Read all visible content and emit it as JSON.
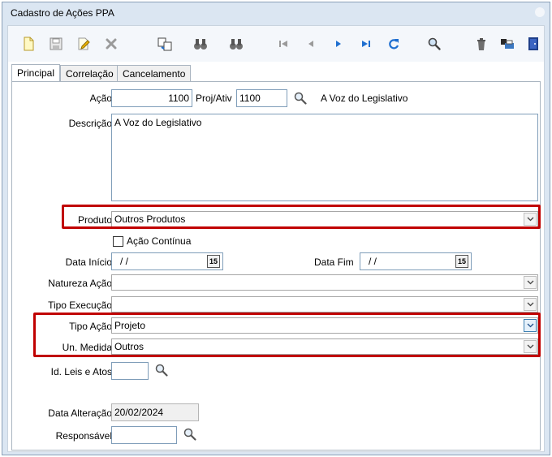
{
  "window": {
    "title": "Cadastro de Ações PPA"
  },
  "toolbar": {
    "buttons": [
      {
        "icon": "new-document-icon"
      },
      {
        "icon": "save-icon"
      },
      {
        "icon": "edit-icon"
      },
      {
        "icon": "delete-icon"
      },
      {
        "icon": "copy-record-icon"
      },
      {
        "icon": "binoculars-icon"
      },
      {
        "icon": "binoculars-next-icon"
      },
      {
        "icon": "first-record-icon"
      },
      {
        "icon": "previous-record-icon"
      },
      {
        "icon": "next-record-icon"
      },
      {
        "icon": "last-record-icon"
      },
      {
        "icon": "refresh-icon"
      },
      {
        "icon": "search-icon"
      },
      {
        "icon": "trash-icon"
      },
      {
        "icon": "print-icon"
      },
      {
        "icon": "exit-door-icon"
      }
    ]
  },
  "tabs": [
    "Principal",
    "Correlação",
    "Cancelamento"
  ],
  "form": {
    "acao": {
      "label": "Ação",
      "value": "1100"
    },
    "proj_ativ": {
      "label": "Proj/Ativ",
      "value": "1100",
      "description": "A Voz do Legislativo"
    },
    "descricao": {
      "label": "Descrição",
      "value": "A Voz do Legislativo"
    },
    "produto": {
      "label": "Produto",
      "value": "Outros Produtos"
    },
    "acao_continua": {
      "label": "Ação Contínua",
      "checked": false
    },
    "data_inicio": {
      "label": "Data Início",
      "value": "/ /"
    },
    "data_fim": {
      "label": "Data Fim",
      "value": "/ /"
    },
    "date_button": "15",
    "natureza_acao": {
      "label": "Natureza Ação",
      "value": ""
    },
    "tipo_execucao": {
      "label": "Tipo Execução",
      "value": ""
    },
    "tipo_acao": {
      "label": "Tipo Ação",
      "value": "Projeto"
    },
    "un_medida": {
      "label": "Un. Medida",
      "value": "Outros"
    },
    "id_leis_atos": {
      "label": "Id. Leis e Atos",
      "value": ""
    },
    "data_alteracao": {
      "label": "Data Alteração",
      "value": "20/02/2024"
    },
    "responsavel": {
      "label": "Responsável",
      "value": ""
    }
  },
  "colors": {
    "highlight": "#c00000",
    "accent": "#1f6fd0"
  }
}
